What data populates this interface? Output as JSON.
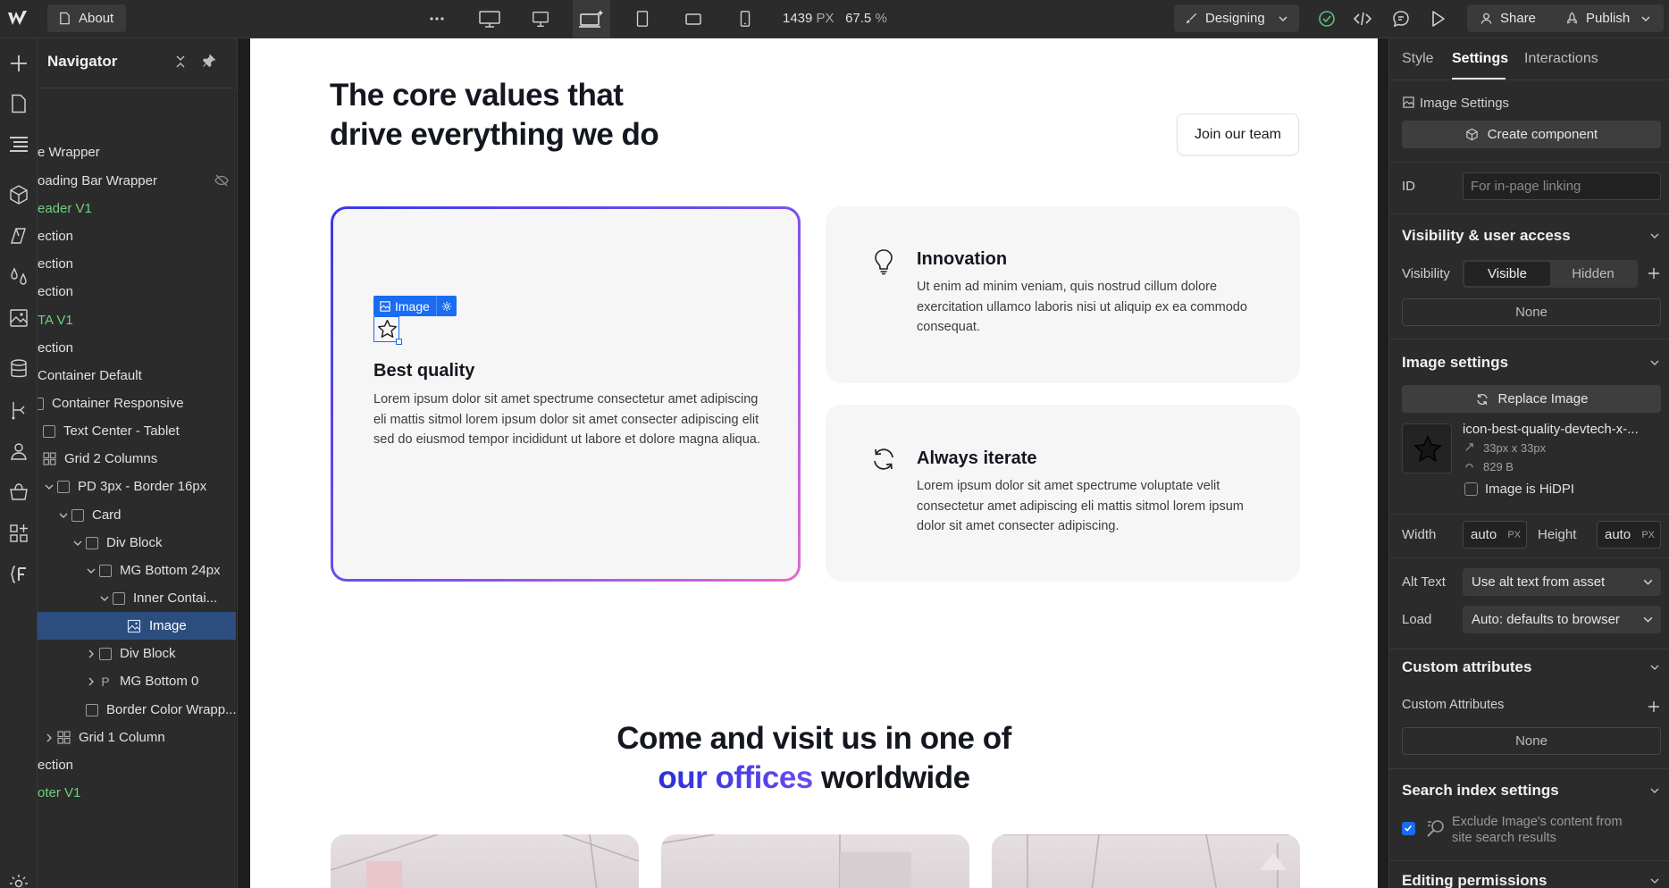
{
  "topbar": {
    "page_name": "About",
    "canvas_width": "1439",
    "canvas_unit": "PX",
    "zoom": "67.5",
    "zoom_unit": "%",
    "mode": "Designing",
    "share_label": "Share",
    "publish_label": "Publish"
  },
  "navigator": {
    "title": "Navigator",
    "items": [
      {
        "label": "e Wrapper"
      },
      {
        "label": "oading Bar Wrapper"
      },
      {
        "label": "eader V1"
      },
      {
        "label": "ection"
      },
      {
        "label": "ection"
      },
      {
        "label": "ection"
      },
      {
        "label": "TA V1"
      },
      {
        "label": "ection"
      },
      {
        "label": "Container Default"
      },
      {
        "label": "Container Responsive"
      },
      {
        "label": "Text Center - Tablet"
      },
      {
        "label": "Grid 2 Columns"
      },
      {
        "label": "PD 3px - Border 16px"
      },
      {
        "label": "Card"
      },
      {
        "label": "Div Block"
      },
      {
        "label": "MG Bottom 24px"
      },
      {
        "label": "Inner Contai..."
      },
      {
        "label": "Image"
      },
      {
        "label": "Div Block"
      },
      {
        "label": "MG Bottom 0"
      },
      {
        "label": "Border Color Wrapp..."
      },
      {
        "label": "Grid 1 Column"
      },
      {
        "label": "ection"
      },
      {
        "label": "oter V1"
      }
    ]
  },
  "canvas": {
    "heading_line1": "The core values that",
    "heading_line2": "drive everything we do",
    "join_button": "Join our team",
    "image_badge": "Image",
    "cards": [
      {
        "title": "Best quality",
        "text": "Lorem ipsum dolor sit amet spectrume consectetur amet adipiscing eli mattis sitmol lorem ipsum dolor sit amet consecter adipiscing elit sed do eiusmod tempor incididunt ut labore et dolore magna aliqua."
      },
      {
        "title": "Innovation",
        "text": "Ut enim ad minim veniam, quis nostrud cillum dolore exercitation ullamco laboris nisi ut aliquip ex ea commodo consequat."
      },
      {
        "title": "Always iterate",
        "text": "Lorem ipsum dolor sit amet spectrume voluptate velit consectetur amet adipiscing eli mattis sitmol lorem ipsum dolor sit amet consecter adipiscing."
      }
    ],
    "visit_line1": "Come and visit us in one of",
    "visit_accent": "our offices",
    "visit_rest": " worldwide"
  },
  "panel": {
    "tabs": [
      "Style",
      "Settings",
      "Interactions"
    ],
    "active_tab": "Settings",
    "image_settings_label": "Image Settings",
    "create_component": "Create component",
    "id_label": "ID",
    "id_placeholder": "For in-page linking",
    "visibility_heading": "Visibility & user access",
    "visibility_label": "Visibility",
    "visible": "Visible",
    "hidden": "Hidden",
    "none_1": "None",
    "image_settings_heading": "Image settings",
    "replace_image": "Replace Image",
    "file_name": "icon-best-quality-devtech-x-...",
    "file_dims": "33px x 33px",
    "file_size": "829 B",
    "hidpi_label": "Image is HiDPI",
    "width_label": "Width",
    "width_value": "auto",
    "height_label": "Height",
    "height_value": "auto",
    "px_unit": "PX",
    "alt_label": "Alt Text",
    "alt_value": "Use alt text from asset",
    "load_label": "Load",
    "load_value": "Auto: defaults to browser",
    "custom_attrs_heading": "Custom attributes",
    "custom_attrs_label": "Custom Attributes",
    "none_2": "None",
    "search_heading": "Search index settings",
    "search_text_1": "Exclude Image's content from",
    "search_text_2": "site search results",
    "editing_heading": "Editing permissions"
  },
  "colors": {
    "selection_blue": "#1a6cf0",
    "navigator_selected": "#2b4e7e",
    "component_green": "#6fcf7e",
    "accent_gradient_start": "#2b2fd9",
    "accent_gradient_end": "#6a4ef0"
  }
}
